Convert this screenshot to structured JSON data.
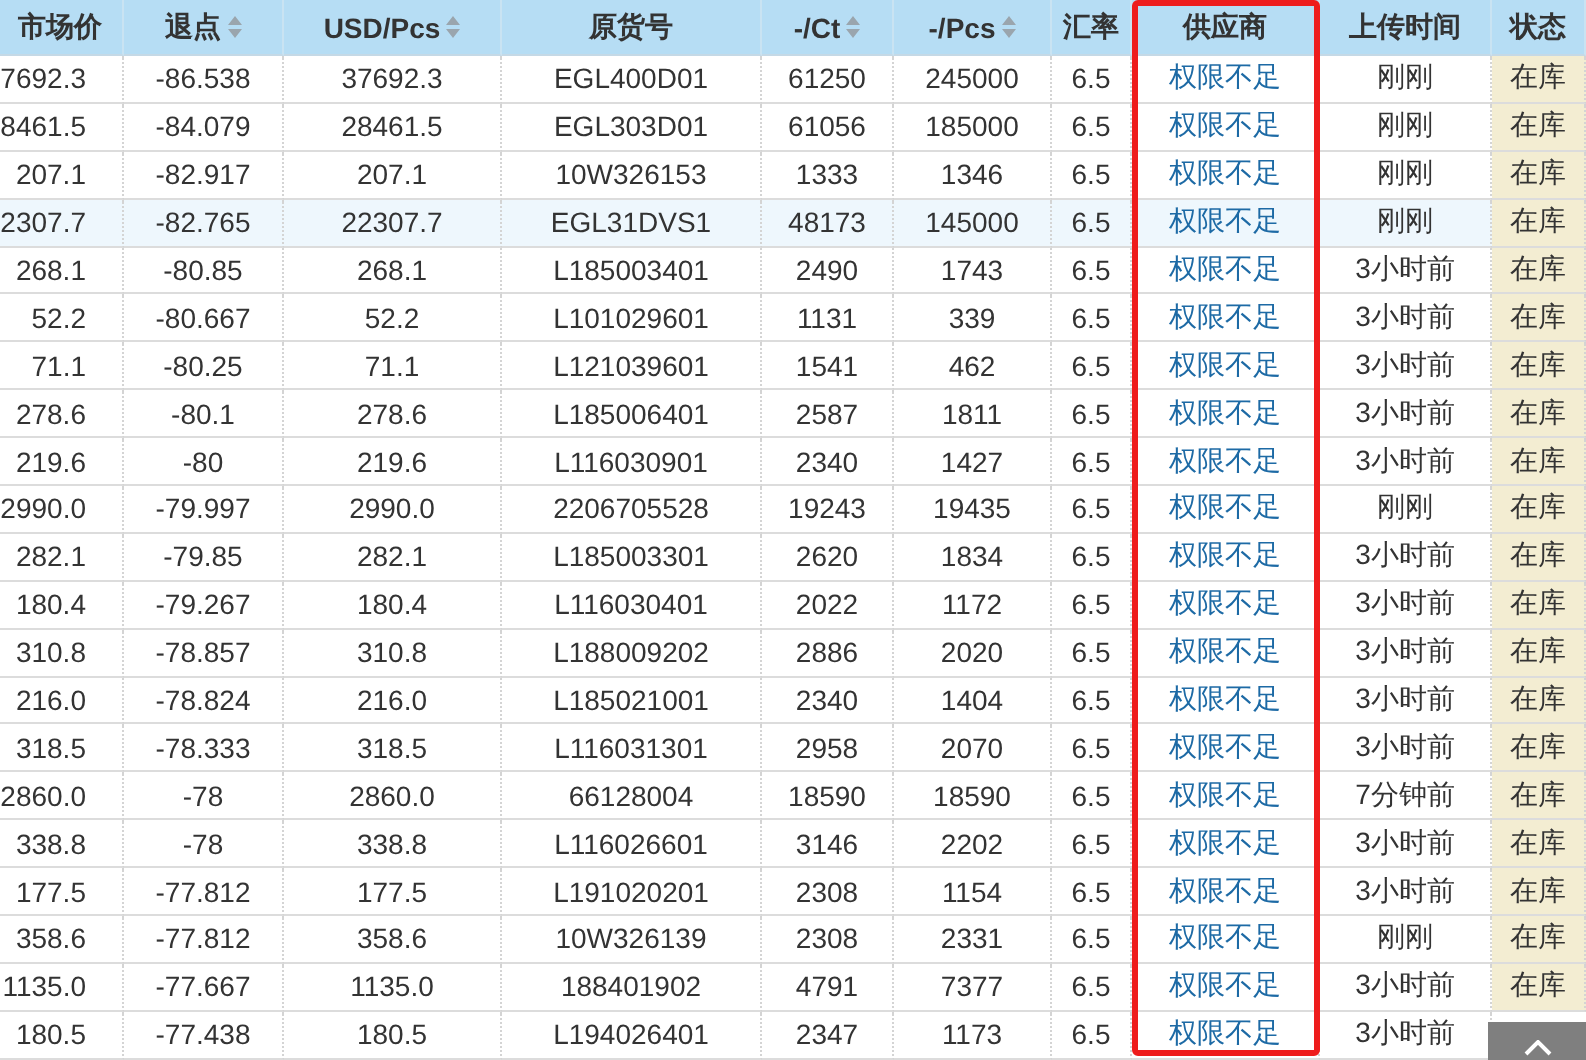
{
  "table": {
    "columns": [
      {
        "label": "市场价",
        "sortable": false,
        "highlighted": false
      },
      {
        "label": "退点",
        "sortable": true,
        "highlighted": false
      },
      {
        "label": "USD/Pcs",
        "sortable": true,
        "highlighted": false
      },
      {
        "label": "原货号",
        "sortable": false,
        "highlighted": false
      },
      {
        "label": "-/Ct",
        "sortable": true,
        "highlighted": false
      },
      {
        "label": "-/Pcs",
        "sortable": true,
        "highlighted": false
      },
      {
        "label": "汇率",
        "sortable": false,
        "highlighted": false
      },
      {
        "label": "供应商",
        "sortable": false,
        "highlighted": true
      },
      {
        "label": "上传时间",
        "sortable": false,
        "highlighted": false
      },
      {
        "label": "状态",
        "sortable": false,
        "highlighted": false
      }
    ],
    "rows": [
      {
        "selected": false,
        "cells": [
          "7692.3",
          "-86.538",
          "37692.3",
          "EGL400D01",
          "61250",
          "245000",
          "6.5",
          "权限不足",
          "刚刚",
          "在库"
        ]
      },
      {
        "selected": false,
        "cells": [
          "8461.5",
          "-84.079",
          "28461.5",
          "EGL303D01",
          "61056",
          "185000",
          "6.5",
          "权限不足",
          "刚刚",
          "在库"
        ]
      },
      {
        "selected": false,
        "cells": [
          "207.1",
          "-82.917",
          "207.1",
          "10W326153",
          "1333",
          "1346",
          "6.5",
          "权限不足",
          "刚刚",
          "在库"
        ]
      },
      {
        "selected": true,
        "cells": [
          "2307.7",
          "-82.765",
          "22307.7",
          "EGL31DVS1",
          "48173",
          "145000",
          "6.5",
          "权限不足",
          "刚刚",
          "在库"
        ]
      },
      {
        "selected": false,
        "cells": [
          "268.1",
          "-80.85",
          "268.1",
          "L185003401",
          "2490",
          "1743",
          "6.5",
          "权限不足",
          "3小时前",
          "在库"
        ]
      },
      {
        "selected": false,
        "cells": [
          "52.2",
          "-80.667",
          "52.2",
          "L101029601",
          "1131",
          "339",
          "6.5",
          "权限不足",
          "3小时前",
          "在库"
        ]
      },
      {
        "selected": false,
        "cells": [
          "71.1",
          "-80.25",
          "71.1",
          "L121039601",
          "1541",
          "462",
          "6.5",
          "权限不足",
          "3小时前",
          "在库"
        ]
      },
      {
        "selected": false,
        "cells": [
          "278.6",
          "-80.1",
          "278.6",
          "L185006401",
          "2587",
          "1811",
          "6.5",
          "权限不足",
          "3小时前",
          "在库"
        ]
      },
      {
        "selected": false,
        "cells": [
          "219.6",
          "-80",
          "219.6",
          "L116030901",
          "2340",
          "1427",
          "6.5",
          "权限不足",
          "3小时前",
          "在库"
        ]
      },
      {
        "selected": false,
        "cells": [
          "2990.0",
          "-79.997",
          "2990.0",
          "2206705528",
          "19243",
          "19435",
          "6.5",
          "权限不足",
          "刚刚",
          "在库"
        ]
      },
      {
        "selected": false,
        "cells": [
          "282.1",
          "-79.85",
          "282.1",
          "L185003301",
          "2620",
          "1834",
          "6.5",
          "权限不足",
          "3小时前",
          "在库"
        ]
      },
      {
        "selected": false,
        "cells": [
          "180.4",
          "-79.267",
          "180.4",
          "L116030401",
          "2022",
          "1172",
          "6.5",
          "权限不足",
          "3小时前",
          "在库"
        ]
      },
      {
        "selected": false,
        "cells": [
          "310.8",
          "-78.857",
          "310.8",
          "L188009202",
          "2886",
          "2020",
          "6.5",
          "权限不足",
          "3小时前",
          "在库"
        ]
      },
      {
        "selected": false,
        "cells": [
          "216.0",
          "-78.824",
          "216.0",
          "L185021001",
          "2340",
          "1404",
          "6.5",
          "权限不足",
          "3小时前",
          "在库"
        ]
      },
      {
        "selected": false,
        "cells": [
          "318.5",
          "-78.333",
          "318.5",
          "L116031301",
          "2958",
          "2070",
          "6.5",
          "权限不足",
          "3小时前",
          "在库"
        ]
      },
      {
        "selected": false,
        "cells": [
          "2860.0",
          "-78",
          "2860.0",
          "66128004",
          "18590",
          "18590",
          "6.5",
          "权限不足",
          "7分钟前",
          "在库"
        ]
      },
      {
        "selected": false,
        "cells": [
          "338.8",
          "-78",
          "338.8",
          "L116026601",
          "3146",
          "2202",
          "6.5",
          "权限不足",
          "3小时前",
          "在库"
        ]
      },
      {
        "selected": false,
        "cells": [
          "177.5",
          "-77.812",
          "177.5",
          "L191020201",
          "2308",
          "1154",
          "6.5",
          "权限不足",
          "3小时前",
          "在库"
        ]
      },
      {
        "selected": false,
        "cells": [
          "358.6",
          "-77.812",
          "358.6",
          "10W326139",
          "2308",
          "2331",
          "6.5",
          "权限不足",
          "刚刚",
          "在库"
        ]
      },
      {
        "selected": false,
        "cells": [
          "1135.0",
          "-77.667",
          "1135.0",
          "188401902",
          "4791",
          "7377",
          "6.5",
          "权限不足",
          "3小时前",
          "在库"
        ]
      },
      {
        "selected": false,
        "cells": [
          "180.5",
          "-77.438",
          "180.5",
          "L194026401",
          "2347",
          "1173",
          "6.5",
          "权限不足",
          "3小时前"
        ]
      }
    ]
  },
  "back_to_top": {
    "kind": "button"
  }
}
